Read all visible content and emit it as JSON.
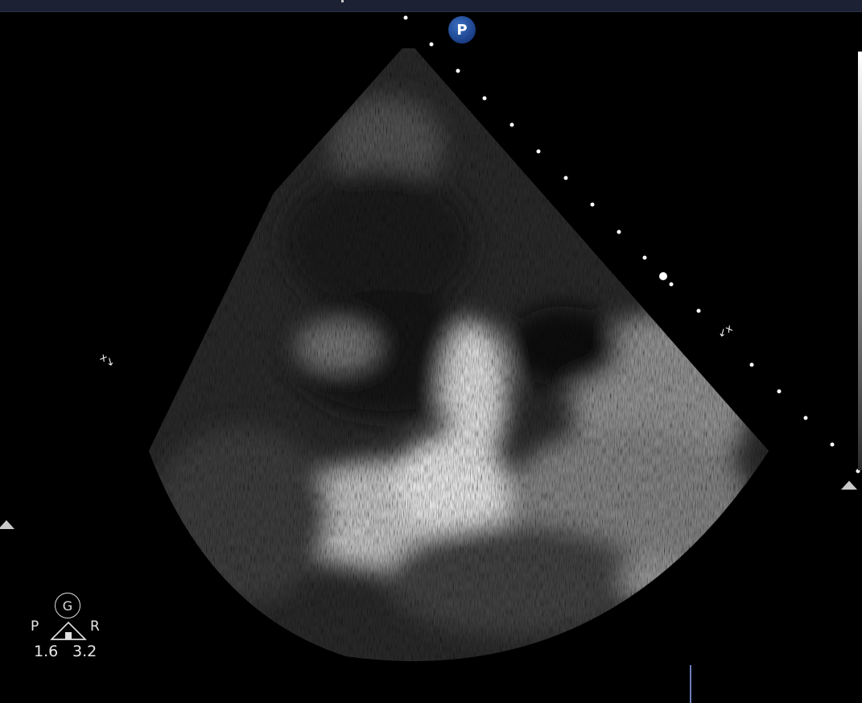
{
  "probe_badge": {
    "label": "P",
    "color": "#2a5aaa"
  },
  "orientation": {
    "left_label": "P",
    "right_label": "R",
    "gain_mark": "G"
  },
  "readouts": {
    "value_left": "1.6",
    "value_right": "3.2"
  },
  "calipers": {
    "left": "x↘",
    "right": "↙x"
  },
  "icons": [
    "probe-p-badge",
    "depth-scale-bar",
    "focus-triangle",
    "caliper-marker",
    "gain-icon",
    "probe-house-icon"
  ]
}
